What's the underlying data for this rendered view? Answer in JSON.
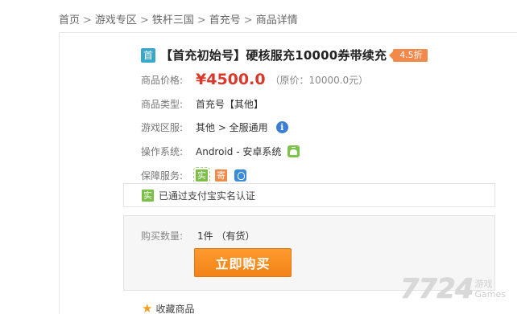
{
  "breadcrumb": {
    "items": [
      "首页",
      "游戏专区",
      "铁杆三国",
      "首充号",
      "商品详情"
    ],
    "separator": ">"
  },
  "product": {
    "badge": "首",
    "title": "【首充初始号】硬核服充10000券带续充",
    "discount": "4.5折"
  },
  "details": {
    "price_label": "商品价格:",
    "price": "¥4500.0",
    "original_price": "（原价：10000.0元）",
    "type_label": "商品类型:",
    "type_value": "首充号【其他】",
    "server_label": "游戏区服:",
    "server_value": "其他 > 全服通用",
    "os_label": "操作系统:",
    "os_value": "Android - 安卓系统",
    "service_label": "保障服务:",
    "service_icons": [
      "实",
      "寄",
      "safe-icon"
    ]
  },
  "verify": {
    "icon": "实",
    "text": "已通过支付宝实名认证"
  },
  "purchase": {
    "qty_label": "购买数量:",
    "qty_value": "1件 （有货）",
    "buy_label": "立即购买"
  },
  "favorite": {
    "label": "收藏商品"
  },
  "watermark": {
    "logo": "7724",
    "side_top": "游戏",
    "side_bottom": "Games"
  },
  "colors": {
    "price": "#d9382b",
    "discount": "#f0894a",
    "buy_button": "#f28318",
    "badge": "#3aa7c9"
  }
}
